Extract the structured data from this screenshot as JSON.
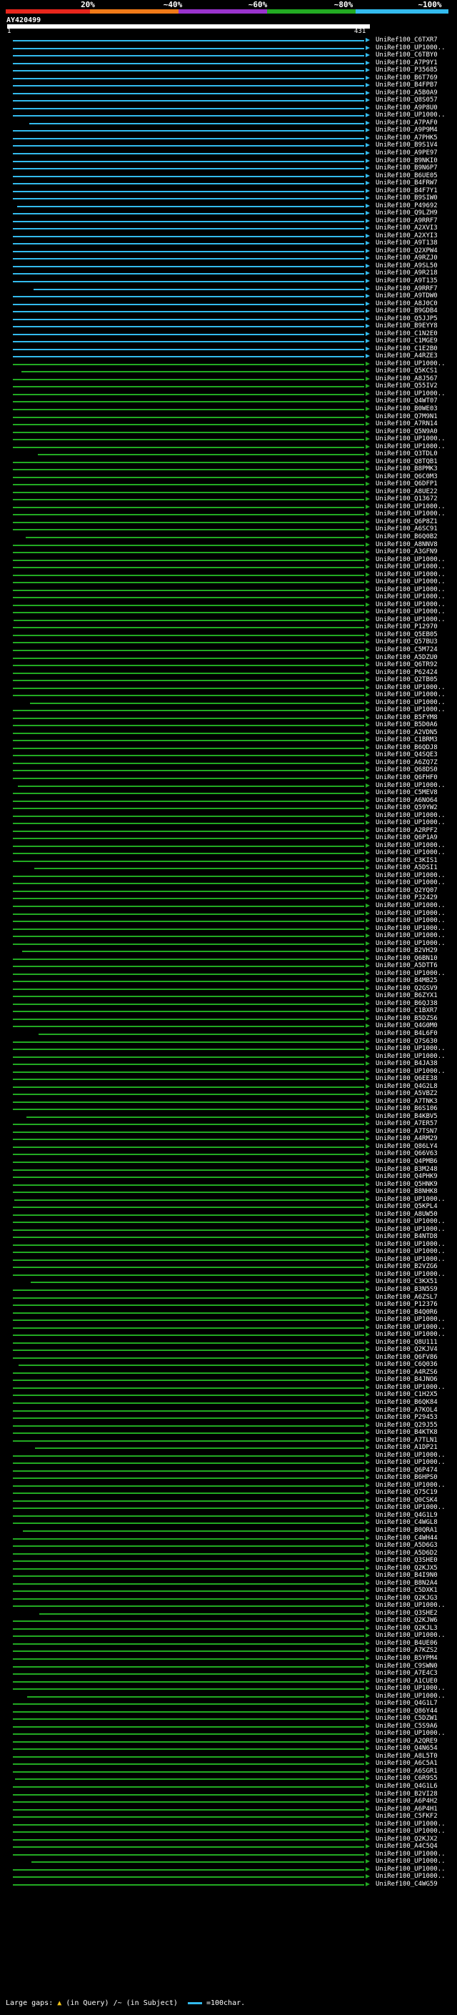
{
  "legend": {
    "labels": [
      "20%",
      "~40%",
      "~60%",
      "~80%",
      "~100%"
    ],
    "colors": [
      "#e8261c",
      "#f07a18",
      "#9933cc",
      "#22aa22",
      "#33bbee"
    ]
  },
  "query": {
    "name": "AY420499",
    "start": "1",
    "end": "431"
  },
  "footer": {
    "large_gaps_label": "Large gaps:",
    "in_query": "(in Query)",
    "in_subject": "/~ (in Subject)",
    "scale": "=100char."
  },
  "colors": {
    "blue": "#33bbee",
    "green": "#22aa22",
    "background": "#000000"
  },
  "hits": [
    "UniRef100_C6TXR7",
    "UniRef100_UP1000..",
    "UniRef100_C6TBY0",
    "UniRef100_A7P9Y1",
    "UniRef100_P35685",
    "UniRef100_B6T769",
    "UniRef100_B4FPB7",
    "UniRef100_A5B0A9",
    "UniRef100_Q8S057",
    "UniRef100_A9P8U0",
    "UniRef100_UP1000..",
    "UniRef100_A7PAF0",
    "UniRef100_A9P9M4",
    "UniRef100_A7PHK5",
    "UniRef100_B9S1V4",
    "UniRef100_A9PE97",
    "UniRef100_B9NKI0",
    "UniRef100_B9N6P7",
    "UniRef100_B6UE05",
    "UniRef100_B4FRW7",
    "UniRef100_B4F7Y1",
    "UniRef100_B9SIW0",
    "UniRef100_P49692",
    "UniRef100_Q9LZH9",
    "UniRef100_A9RRF7",
    "UniRef100_A2XVI3",
    "UniRef100_A2XYI3",
    "UniRef100_A9T138",
    "UniRef100_Q2XPW4",
    "UniRef100_A9RZJ0",
    "UniRef100_A9SL50",
    "UniRef100_A9R218",
    "UniRef100_A9T135",
    "UniRef100_A9RRF7",
    "UniRef100_A9TDW0",
    "UniRef100_A8J0C0",
    "UniRef100_B9GDB4",
    "UniRef100_Q5JJP5",
    "UniRef100_B9EYY8",
    "UniRef100_C1N2E0",
    "UniRef100_C1MGE9",
    "UniRef100_C1E2B0",
    "UniRef100_A4RZE3",
    "UniRef100_UP1000..",
    "UniRef100_Q5KCS1",
    "UniRef100_A8J567",
    "UniRef100_Q55IV2",
    "UniRef100_UP1000..",
    "UniRef100_Q4WT07",
    "UniRef100_B0WE03",
    "UniRef100_Q7M9N1",
    "UniRef100_A7RN14",
    "UniRef100_Q5N9A0",
    "UniRef100_UP1000..",
    "UniRef100_UP1000..",
    "UniRef100_Q3TDL0",
    "UniRef100_Q8TQB1",
    "UniRef100_B8PMK3",
    "UniRef100_Q6C0M3",
    "UniRef100_Q6DFP1",
    "UniRef100_A8UE22",
    "UniRef100_Q13672",
    "UniRef100_UP1000..",
    "UniRef100_UP1000..",
    "UniRef100_Q6P8Z1",
    "UniRef100_A6SC91",
    "UniRef100_B6Q0B2",
    "UniRef100_A8NNV8",
    "UniRef100_A3GFN9",
    "UniRef100_UP1000..",
    "UniRef100_UP1000..",
    "UniRef100_UP1000..",
    "UniRef100_UP1000..",
    "UniRef100_UP1000..",
    "UniRef100_UP1000..",
    "UniRef100_UP1000..",
    "UniRef100_UP1000..",
    "UniRef100_UP1000..",
    "UniRef100_P12970",
    "UniRef100_Q5EB05",
    "UniRef100_Q57BU3",
    "UniRef100_C5M724",
    "UniRef100_A5DZU0",
    "UniRef100_Q6TR92",
    "UniRef100_P62424",
    "UniRef100_Q2TB05",
    "UniRef100_UP1000..",
    "UniRef100_UP1000..",
    "UniRef100_UP1000..",
    "UniRef100_UP1000..",
    "UniRef100_B5FYM8",
    "UniRef100_B5D0A6",
    "UniRef100_A2VDN5",
    "UniRef100_C1BRM3",
    "UniRef100_B6QDJ8",
    "UniRef100_Q4SQE3",
    "UniRef100_A6ZQ7Z",
    "UniRef100_Q68DS0",
    "UniRef100_Q6FHF0",
    "UniRef100_UP1000..",
    "UniRef100_C5MEV8",
    "UniRef100_A6NO64",
    "UniRef100_Q59YW2",
    "UniRef100_UP1000..",
    "UniRef100_UP1000..",
    "UniRef100_A2RPF2",
    "UniRef100_Q6P1A9",
    "UniRef100_UP1000..",
    "UniRef100_UP1000..",
    "UniRef100_C3KIS1",
    "UniRef100_A5DSI1",
    "UniRef100_UP1000..",
    "UniRef100_UP1000..",
    "UniRef100_Q2YQ07",
    "UniRef100_P32429",
    "UniRef100_UP1000..",
    "UniRef100_UP1000..",
    "UniRef100_UP1000..",
    "UniRef100_UP1000..",
    "UniRef100_UP1000..",
    "UniRef100_UP1000..",
    "UniRef100_B2VH29",
    "UniRef100_Q6BN10",
    "UniRef100_A5DTT6",
    "UniRef100_UP1000..",
    "UniRef100_B4MB25",
    "UniRef100_Q2GSV9",
    "UniRef100_B6ZYX1",
    "UniRef100_B6QJ38",
    "UniRef100_C1BXR7",
    "UniRef100_B5DZS6",
    "UniRef100_Q4G0M0",
    "UniRef100_B4L6F0",
    "UniRef100_Q7S630",
    "UniRef100_UP1000..",
    "UniRef100_UP1000..",
    "UniRef100_B4JA38",
    "UniRef100_UP1000..",
    "UniRef100_Q6EE38",
    "UniRef100_Q4G2L8",
    "UniRef100_A5VBZ2",
    "UniRef100_A7TNK3",
    "UniRef100_B6S106",
    "UniRef100_B4KBV5",
    "UniRef100_A7ER57",
    "UniRef100_A7TSN7",
    "UniRef100_A4RM29",
    "UniRef100_Q86LY4",
    "UniRef100_Q66V63",
    "UniRef100_Q4PMB6",
    "UniRef100_B3M248",
    "UniRef100_Q4PHK9",
    "UniRef100_Q5HNK9",
    "UniRef100_B8NHK8",
    "UniRef100_UP1000..",
    "UniRef100_Q5KPL4",
    "UniRef100_A8UW50",
    "UniRef100_UP1000..",
    "UniRef100_UP1000..",
    "UniRef100_B4NTD8",
    "UniRef100_UP1000..",
    "UniRef100_UP1000..",
    "UniRef100_UP1000..",
    "UniRef100_B2VZG6",
    "UniRef100_UP1000..",
    "UniRef100_C3KX51",
    "UniRef100_B3N5S9",
    "UniRef100_A6ZSL7",
    "UniRef100_P12376",
    "UniRef100_B4Q0R6",
    "UniRef100_UP1000..",
    "UniRef100_UP1000..",
    "UniRef100_UP1000..",
    "UniRef100_Q8U111",
    "UniRef100_Q2KJV4",
    "UniRef100_Q6FV86",
    "UniRef100_C6Q036",
    "UniRef100_A4RZS6",
    "UniRef100_B4JNO6",
    "UniRef100_UP1000..",
    "UniRef100_C1H2X5",
    "UniRef100_B6QK84",
    "UniRef100_A7KOL4",
    "UniRef100_P29453",
    "UniRef100_Q29J55",
    "UniRef100_B4KTK8",
    "UniRef100_A7TLN1",
    "UniRef100_A1DP21",
    "UniRef100_UP1000..",
    "UniRef100_UP1000..",
    "UniRef100_Q6P474",
    "UniRef100_B6HPS0",
    "UniRef100_UP1000..",
    "UniRef100_Q75C19",
    "UniRef100_Q0CSK4",
    "UniRef100_UP1000..",
    "UniRef100_Q4G1L9",
    "UniRef100_C4WGL8",
    "UniRef100_B0QRA1",
    "UniRef100_C4WH44",
    "UniRef100_A5D6G3",
    "UniRef100_A5D6D2",
    "UniRef100_Q3SHE0",
    "UniRef100_Q2KJX5",
    "UniRef100_B4I9N0",
    "UniRef100_B8N2A4",
    "UniRef100_C5DXK1",
    "UniRef100_Q2KJG3",
    "UniRef100_UP1000..",
    "UniRef100_Q3SHE2",
    "UniRef100_Q2KJW6",
    "UniRef100_Q2KJL3",
    "UniRef100_UP1000..",
    "UniRef100_B4UE06",
    "UniRef100_A7KZS2",
    "UniRef100_B5YPM4",
    "UniRef100_C9SWN0",
    "UniRef100_A7E4C3",
    "UniRef100_A1CUE0",
    "UniRef100_UP1000..",
    "UniRef100_UP1000..",
    "UniRef100_Q4G1L7",
    "UniRef100_Q86Y44",
    "UniRef100_C5DZW1",
    "UniRef100_C5S9A6",
    "UniRef100_UP1000..",
    "UniRef100_A2QRE9",
    "UniRef100_Q4N654",
    "UniRef100_A8L5T0",
    "UniRef100_A6C5A1",
    "UniRef100_A6SGR1",
    "UniRef100_C6R9S5",
    "UniRef100_Q4G1L6",
    "UniRef100_B2VI28",
    "UniRef100_A6P4H2",
    "UniRef100_A6P4H1",
    "UniRef100_C5FKF2",
    "UniRef100_UP1000..",
    "UniRef100_UP1000..",
    "UniRef100_Q2KJX2",
    "UniRef100_A4C5Q4",
    "UniRef100_UP1000..",
    "UniRef100_UP1000..",
    "UniRef100_UP1000..",
    "UniRef100_UP1000..",
    "UniRef100_C4WG59"
  ]
}
